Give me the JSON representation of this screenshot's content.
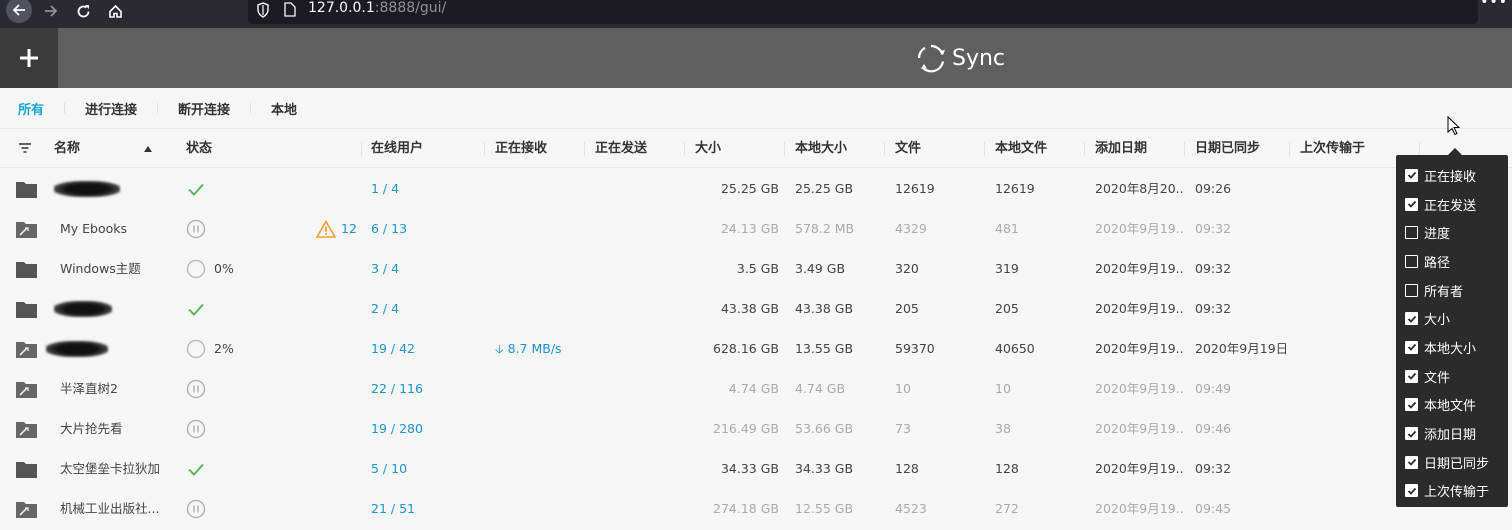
{
  "browser": {
    "url_host": "127.0.0.1",
    "url_rest": ":8888/gui/"
  },
  "app": {
    "title": "Sync",
    "add_button_icon": "plus-icon"
  },
  "tabs": [
    {
      "label": "所有",
      "active": true
    },
    {
      "label": "进行连接",
      "active": false
    },
    {
      "label": "断开连接",
      "active": false
    },
    {
      "label": "本地",
      "active": false
    }
  ],
  "columns": {
    "name": "名称",
    "status": "状态",
    "peers": "在线用户",
    "receiving": "正在接收",
    "sending": "正在发送",
    "size": "大小",
    "local_size": "本地大小",
    "files": "文件",
    "local_files": "本地文件",
    "added": "添加日期",
    "synced": "日期已同步",
    "last_transfer": "上次传输于"
  },
  "rows": [
    {
      "icon": "folder",
      "name": "",
      "status": "synced",
      "status_text": "",
      "peers": "1 / 4",
      "receiving": "",
      "size": "25.25 GB",
      "local_size": "25.25 GB",
      "files": "12619",
      "local_files": "12619",
      "added": "2020年8月20...",
      "synced": "09:26",
      "paused": false
    },
    {
      "icon": "folder-partial",
      "name": "My Ebooks",
      "status": "paused",
      "status_text": "",
      "warning_count": "12",
      "peers": "6 / 13",
      "receiving": "",
      "size": "24.13 GB",
      "local_size": "578.2 MB",
      "files": "4329",
      "local_files": "481",
      "added": "2020年9月19...",
      "synced": "09:32",
      "paused": true
    },
    {
      "icon": "folder",
      "name": "Windows主题",
      "status": "progress",
      "status_text": "0%",
      "peers": "3 / 4",
      "receiving": "",
      "size": "3.5 GB",
      "local_size": "3.49 GB",
      "files": "320",
      "local_files": "319",
      "added": "2020年9月19...",
      "synced": "09:32",
      "paused": false
    },
    {
      "icon": "folder",
      "name": "",
      "status": "synced",
      "status_text": "",
      "peers": "2 / 4",
      "receiving": "",
      "size": "43.38 GB",
      "local_size": "43.38 GB",
      "files": "205",
      "local_files": "205",
      "added": "2020年9月19...",
      "synced": "09:32",
      "paused": false
    },
    {
      "icon": "folder-partial",
      "name": "",
      "status": "progress",
      "status_text": "2%",
      "peers": "19 / 42",
      "receiving": "8.7 MB/s",
      "size": "628.16 GB",
      "local_size": "13.55 GB",
      "files": "59370",
      "local_files": "40650",
      "added": "2020年9月19...",
      "synced": "2020年9月19日",
      "paused": false
    },
    {
      "icon": "folder-partial",
      "name": "半泽直树2",
      "status": "paused",
      "status_text": "",
      "peers": "22 / 116",
      "receiving": "",
      "size": "4.74 GB",
      "local_size": "4.74 GB",
      "files": "10",
      "local_files": "10",
      "added": "2020年9月19...",
      "synced": "09:49",
      "paused": true
    },
    {
      "icon": "folder-partial",
      "name": "大片抢先看",
      "status": "paused",
      "status_text": "",
      "peers": "19 / 280",
      "receiving": "",
      "size": "216.49 GB",
      "local_size": "53.66 GB",
      "files": "73",
      "local_files": "38",
      "added": "2020年9月19...",
      "synced": "09:46",
      "paused": true
    },
    {
      "icon": "folder",
      "name": "太空堡垒卡拉狄加",
      "status": "synced",
      "status_text": "",
      "peers": "5 / 10",
      "receiving": "",
      "size": "34.33 GB",
      "local_size": "34.33 GB",
      "files": "128",
      "local_files": "128",
      "added": "2020年9月19...",
      "synced": "09:32",
      "paused": false
    },
    {
      "icon": "folder-partial",
      "name": "机械工业出版社...",
      "status": "paused",
      "status_text": "",
      "peers": "21 / 51",
      "receiving": "",
      "size": "274.18 GB",
      "local_size": "12.55 GB",
      "files": "4523",
      "local_files": "272",
      "added": "2020年9月19...",
      "synced": "09:45",
      "paused": true
    }
  ],
  "column_menu": [
    {
      "label": "正在接收",
      "checked": true
    },
    {
      "label": "正在发送",
      "checked": true
    },
    {
      "label": "进度",
      "checked": false
    },
    {
      "label": "路径",
      "checked": false
    },
    {
      "label": "所有者",
      "checked": false
    },
    {
      "label": "大小",
      "checked": true
    },
    {
      "label": "本地大小",
      "checked": true
    },
    {
      "label": "文件",
      "checked": true
    },
    {
      "label": "本地文件",
      "checked": true
    },
    {
      "label": "添加日期",
      "checked": true
    },
    {
      "label": "日期已同步",
      "checked": true
    },
    {
      "label": "上次传输于",
      "checked": true
    }
  ],
  "colors": {
    "accent": "#19a6d8",
    "synced_green": "#5cb85c",
    "warning_orange": "#f0a030",
    "header_bg": "#5f5f5f"
  }
}
